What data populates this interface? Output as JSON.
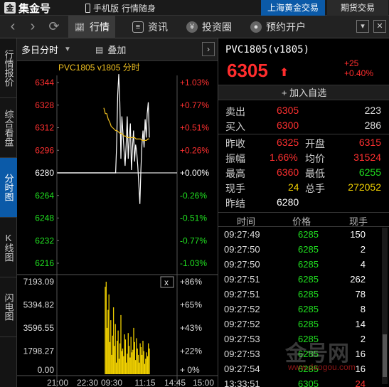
{
  "topbar": {
    "logo": "集金号",
    "mobile": "手机版",
    "slogan": "行情随身",
    "tabs": [
      "上海黄金交易",
      "期货交易"
    ]
  },
  "navbar": {
    "items": [
      {
        "label": "行情",
        "icon": "chart-icon",
        "active": true
      },
      {
        "label": "资讯",
        "icon": "news-icon",
        "active": false
      },
      {
        "label": "投资圈",
        "icon": "yen-icon",
        "active": false
      },
      {
        "label": "预约开户",
        "icon": "account-icon",
        "active": false
      }
    ]
  },
  "lefttabs": [
    {
      "label": "行情报价",
      "active": false
    },
    {
      "label": "综合看盘",
      "active": false
    },
    {
      "label": "分时图",
      "active": true
    },
    {
      "label": "K线图",
      "active": false
    },
    {
      "label": "闪电图",
      "active": false
    }
  ],
  "chart_head": {
    "period": "多日分时",
    "overlay": "叠加"
  },
  "chart_data": {
    "type": "line",
    "title": "PVC1805 v1805 分时",
    "ylim": [
      6216,
      6344
    ],
    "y_ticks": [
      6344,
      6328,
      6312,
      6296,
      6280,
      6264,
      6248,
      6232,
      6216
    ],
    "pct_ticks": [
      "+1.03%",
      "+0.77%",
      "+0.51%",
      "+0.26%",
      "+0.00%",
      "-0.26%",
      "-0.51%",
      "-0.77%",
      "-1.03%"
    ],
    "prev_settle": 6280,
    "x_labels": [
      "21:00",
      "22:30",
      "09:30",
      "11:15",
      "14:45",
      "15:00"
    ],
    "series": [
      {
        "values": [
          6280,
          6280,
          6280,
          6280,
          6280,
          6280,
          6280,
          6280,
          6280,
          6280,
          6280,
          6280,
          6280,
          6280,
          6280,
          6280,
          6280,
          6280,
          6280,
          6280,
          6280,
          6280,
          6280,
          6280,
          6280,
          6280,
          6280,
          6280,
          6280,
          6280,
          6280,
          6280,
          6280,
          6280,
          6280,
          6280,
          6280,
          6280,
          6280,
          6280,
          6280,
          6280,
          6280,
          6280,
          6280,
          6280,
          6280,
          6280,
          6280,
          6280,
          6280,
          6280,
          6280,
          6280,
          6280,
          6280,
          6300,
          6335,
          6350,
          6330,
          6290,
          6320,
          6308,
          6296,
          6285,
          6300,
          6320,
          6290,
          6305,
          6315,
          6282,
          6298,
          6310,
          6288,
          6300,
          6295,
          6285,
          6272,
          6258,
          6282,
          6300,
          6310,
          6298,
          6318,
          6305,
          6322,
          6330,
          6305
        ]
      },
      {
        "values": [
          6326,
          6322,
          6322,
          6318,
          6316,
          6313,
          6312,
          6311,
          6310,
          6310,
          6309,
          6308,
          6308,
          6307,
          6306,
          6306,
          6305,
          6305,
          6305,
          6305,
          6305,
          6305,
          6304,
          6304,
          6304,
          6304,
          6303,
          6303,
          6303,
          6303,
          6304,
          6304
        ]
      }
    ],
    "volume": {
      "ylim": [
        0,
        7193.09
      ],
      "y_ticks": [
        "7193.09",
        "5394.82",
        "3596.55",
        "1798.27",
        "0.00"
      ],
      "pct_ticks": [
        "+86%",
        "+65%",
        "+43%",
        "+22%",
        "+ 0%"
      ],
      "values": [
        6800,
        7193,
        3600,
        5000,
        6200,
        2500,
        4200,
        1500,
        3000,
        5200,
        2200,
        3900,
        900,
        2600,
        3400,
        1200,
        2400,
        4600,
        1800,
        2000,
        1400,
        3100,
        2700,
        900,
        1600,
        3200,
        2200,
        1300,
        2900,
        1700,
        1900,
        3600,
        2500,
        1100,
        2800,
        2000,
        1500,
        900,
        2400,
        2100,
        1500,
        2600,
        1800,
        800,
        1200,
        1700,
        1400,
        2400,
        2000
      ]
    },
    "colors": {
      "price_line": "#ffffff",
      "avg_line": "#f0c020",
      "volume": "#f0d000",
      "up": "#ff3030",
      "down": "#20e020"
    }
  },
  "quote": {
    "symbol": "PVC1805(v1805)",
    "price": "6305",
    "change": "+25",
    "change_pct": "+0.40%",
    "add_watch": "加入自选",
    "sell": {
      "label": "卖出",
      "price": "6305",
      "qty": "223"
    },
    "buy": {
      "label": "买入",
      "price": "6300",
      "qty": "286"
    },
    "stats": [
      {
        "l1": "昨收",
        "v1": "6325",
        "l2": "开盘",
        "v2": "6315"
      },
      {
        "l1": "振幅",
        "v1": "1.66%",
        "l2": "均价",
        "v2": "31524"
      },
      {
        "l1": "最高",
        "v1": "6360",
        "l2": "最低",
        "v2": "6255"
      },
      {
        "l1": "现手",
        "v1": "24",
        "l2": "总手",
        "v2": "272052"
      },
      {
        "l1": "昨结",
        "v1": "6280",
        "l2": "",
        "v2": ""
      }
    ],
    "trade_head": {
      "time": "时间",
      "price": "价格",
      "qty": "现手"
    },
    "trades": [
      {
        "time": "09:27:49",
        "price": "6285",
        "qty": "150"
      },
      {
        "time": "09:27:50",
        "price": "6285",
        "qty": "2"
      },
      {
        "time": "09:27:50",
        "price": "6285",
        "qty": "4"
      },
      {
        "time": "09:27:51",
        "price": "6285",
        "qty": "262"
      },
      {
        "time": "09:27:51",
        "price": "6285",
        "qty": "78"
      },
      {
        "time": "09:27:52",
        "price": "6285",
        "qty": "8"
      },
      {
        "time": "09:27:52",
        "price": "6285",
        "qty": "14"
      },
      {
        "time": "09:27:53",
        "price": "6285",
        "qty": "2"
      },
      {
        "time": "09:27:53",
        "price": "6285",
        "qty": "16"
      },
      {
        "time": "09:27:54",
        "price": "6285",
        "qty": "16"
      },
      {
        "time": "13:33:51",
        "price": "6305",
        "qty": "24"
      }
    ],
    "watermark": "金号网",
    "watermark_url": "www.daogou.com"
  }
}
